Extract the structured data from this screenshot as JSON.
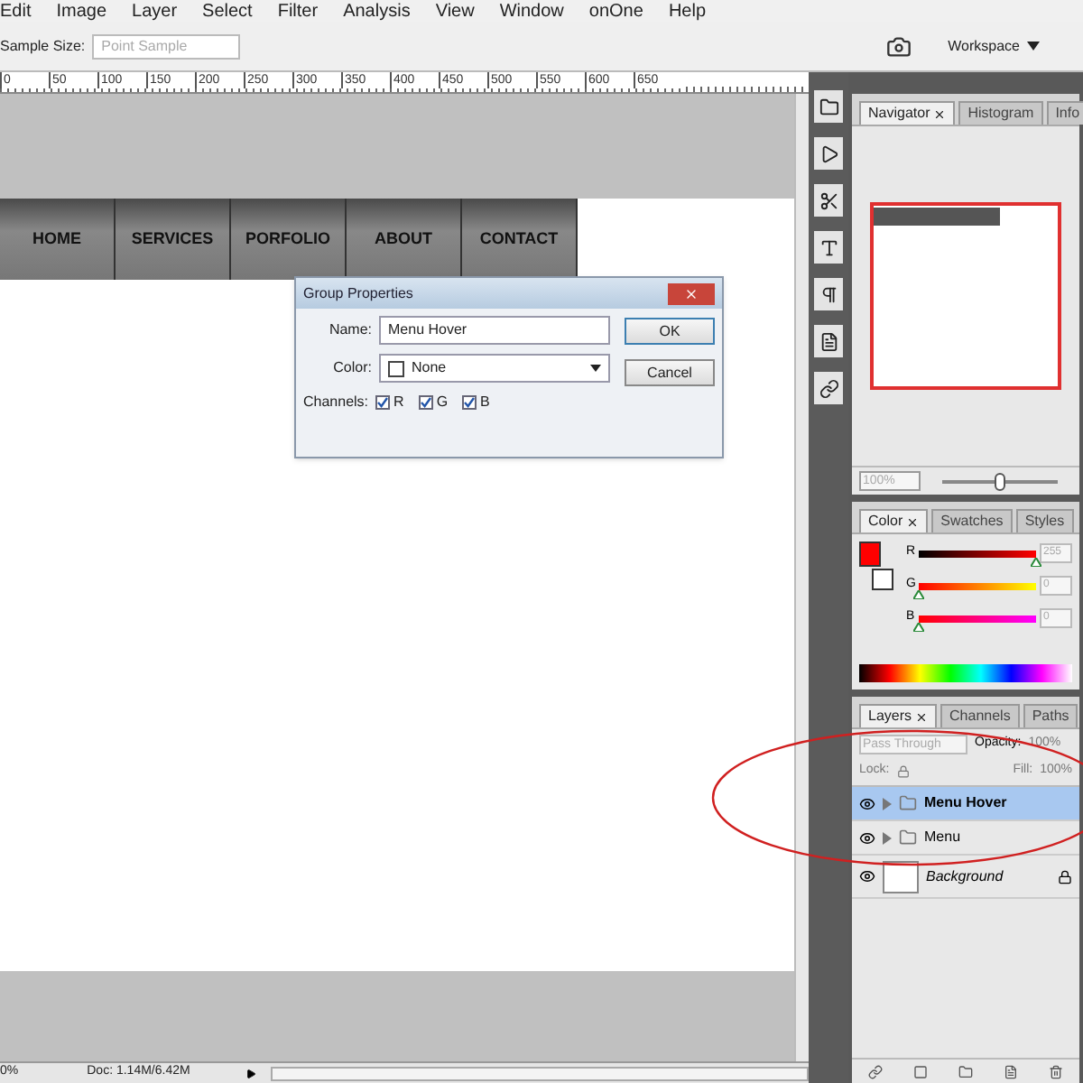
{
  "menu_bar": [
    "Edit",
    "Image",
    "Layer",
    "Select",
    "Filter",
    "Analysis",
    "View",
    "Window",
    "onOne",
    "Help"
  ],
  "options_bar": {
    "sample_size_label": "Sample Size:",
    "sample_size_value": "Point Sample",
    "workspace": "Workspace"
  },
  "ruler": {
    "labels": [
      "0",
      "50",
      "100",
      "150",
      "200",
      "250",
      "300",
      "350",
      "400",
      "450",
      "500",
      "550",
      "600",
      "650"
    ]
  },
  "document": {
    "nav_items": [
      "HOME",
      "SERVICES",
      "PORFOLIO",
      "ABOUT",
      "CONTACT"
    ]
  },
  "dialog": {
    "title": "Group Properties",
    "name_label": "Name:",
    "name_value": "Menu Hover",
    "color_label": "Color:",
    "color_value": "None",
    "channels_label": "Channels:",
    "channels": [
      {
        "label": "R",
        "checked": true
      },
      {
        "label": "G",
        "checked": true
      },
      {
        "label": "B",
        "checked": true
      }
    ],
    "buttons": [
      "OK",
      "Cancel"
    ]
  },
  "navigator_panel": {
    "tabs": [
      {
        "label": "Navigator",
        "selected": true
      },
      {
        "label": "Histogram",
        "selected": false
      },
      {
        "label": "Info",
        "selected": false
      }
    ],
    "zoom": "100%",
    "zoom_slider": {
      "level": 0.5
    }
  },
  "color_panel": {
    "tabs": [
      {
        "label": "Color",
        "selected": true
      },
      {
        "label": "Swatches",
        "selected": false
      },
      {
        "label": "Styles",
        "selected": false
      }
    ],
    "channels": [
      {
        "name": "R",
        "value": "255",
        "level": 1
      },
      {
        "name": "G",
        "value": "0",
        "level": 0
      },
      {
        "name": "B",
        "value": "0",
        "level": 0
      }
    ]
  },
  "layers_panel": {
    "tabs": [
      {
        "label": "Layers",
        "selected": true
      },
      {
        "label": "Channels",
        "selected": false
      },
      {
        "label": "Paths",
        "selected": false
      }
    ],
    "blend_mode": "Pass Through",
    "opacity_label": "Opacity:",
    "opacity": "100%",
    "lock_label": "Lock:",
    "fill_label": "Fill:",
    "fill": "100%",
    "layers": [
      {
        "name": "Menu Hover",
        "kind": "group",
        "selected": true,
        "locked": false
      },
      {
        "name": "Menu",
        "kind": "group",
        "selected": false,
        "locked": false
      },
      {
        "name": "Background",
        "kind": "layer",
        "selected": false,
        "locked": true
      }
    ]
  },
  "status_bar": {
    "zoom": "0%",
    "doc": "Doc: 1.14M/6.42M"
  }
}
